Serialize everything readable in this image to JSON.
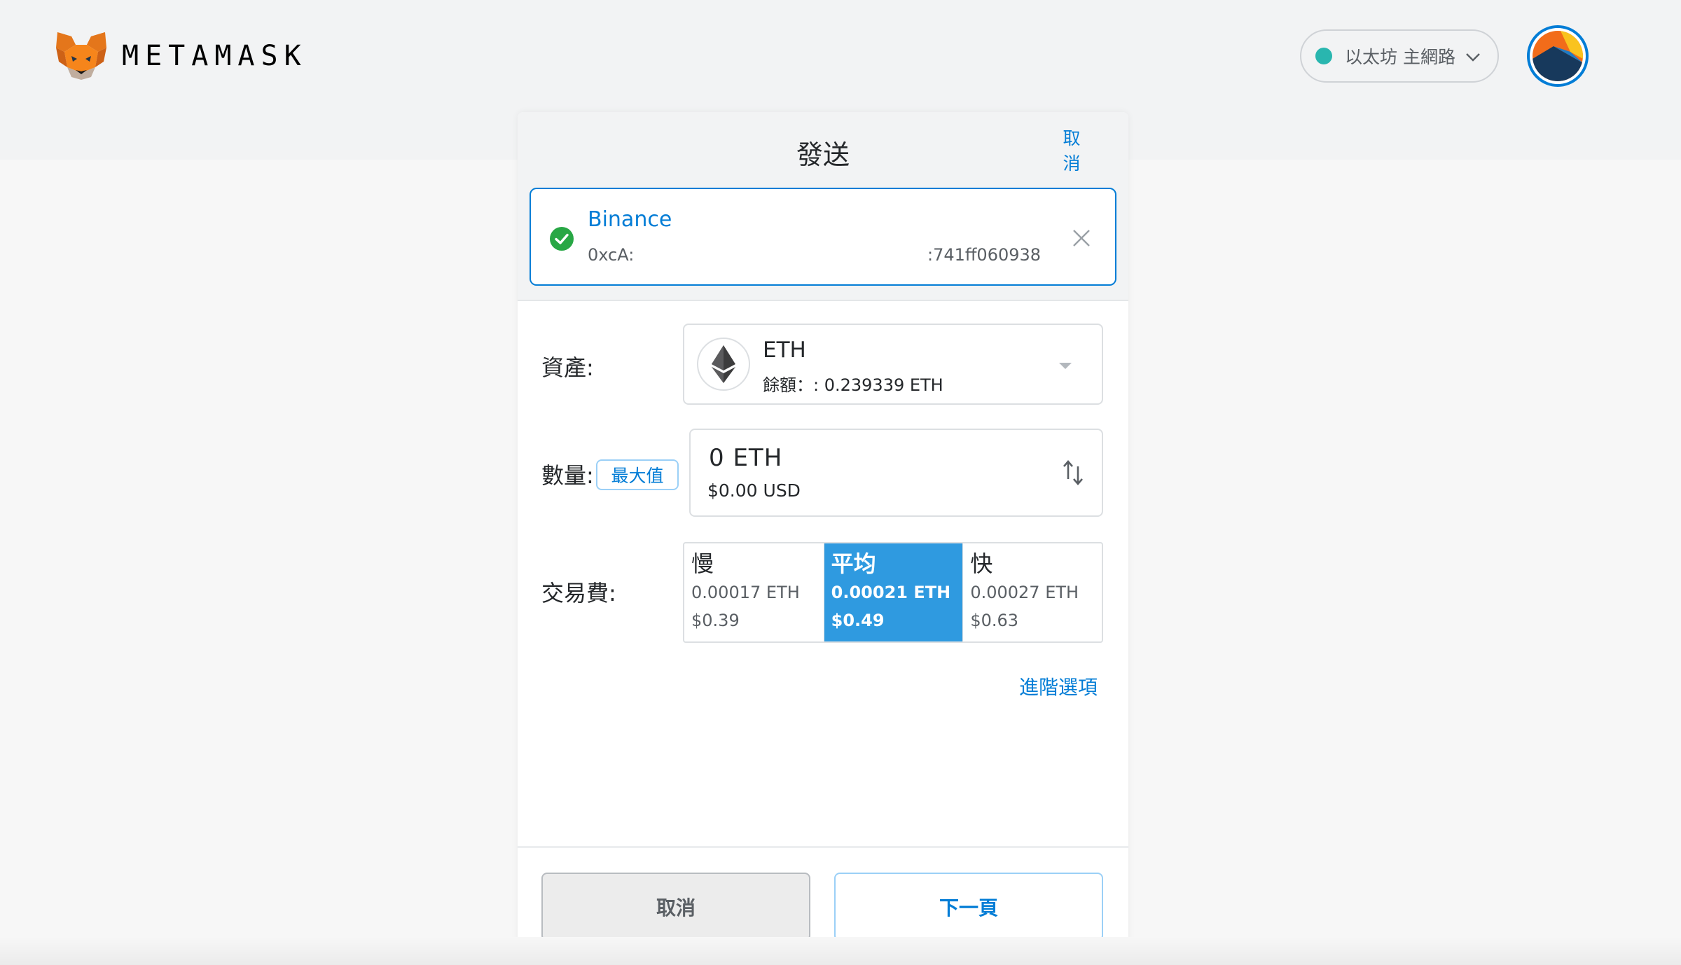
{
  "app": {
    "brand": "METAMASK",
    "network": {
      "label": "以太坊 主網路",
      "status_color": "#29b6af"
    },
    "accent": "#037dd6"
  },
  "send": {
    "title": "發送",
    "header_cancel": "取消",
    "recipient": {
      "name": "Binance",
      "address_start": "0xcA:",
      "address_end": ":741ff060938",
      "verified_icon": "check-circle-icon",
      "clear_icon": "close-icon"
    },
    "asset": {
      "label": "資產:",
      "symbol": "ETH",
      "balance": "餘額：: 0.239339 ETH",
      "icon": "ethereum-icon"
    },
    "amount": {
      "label": "數量:",
      "max_label": "最大值",
      "value": "0  ETH",
      "fiat": "$0.00 USD",
      "swap_icon": "swap-vertical-icon"
    },
    "fee": {
      "label": "交易費:",
      "selected": "average",
      "options": [
        {
          "id": "slow",
          "name": "慢",
          "eth": "0.00017 ETH",
          "usd": "$0.39"
        },
        {
          "id": "average",
          "name": "平均",
          "eth": "0.00021 ETH",
          "usd": "$0.49"
        },
        {
          "id": "fast",
          "name": "快",
          "eth": "0.00027 ETH",
          "usd": "$0.63"
        }
      ]
    },
    "advanced_link": "進階選項",
    "footer": {
      "cancel_label": "取消",
      "next_label": "下一頁"
    }
  }
}
